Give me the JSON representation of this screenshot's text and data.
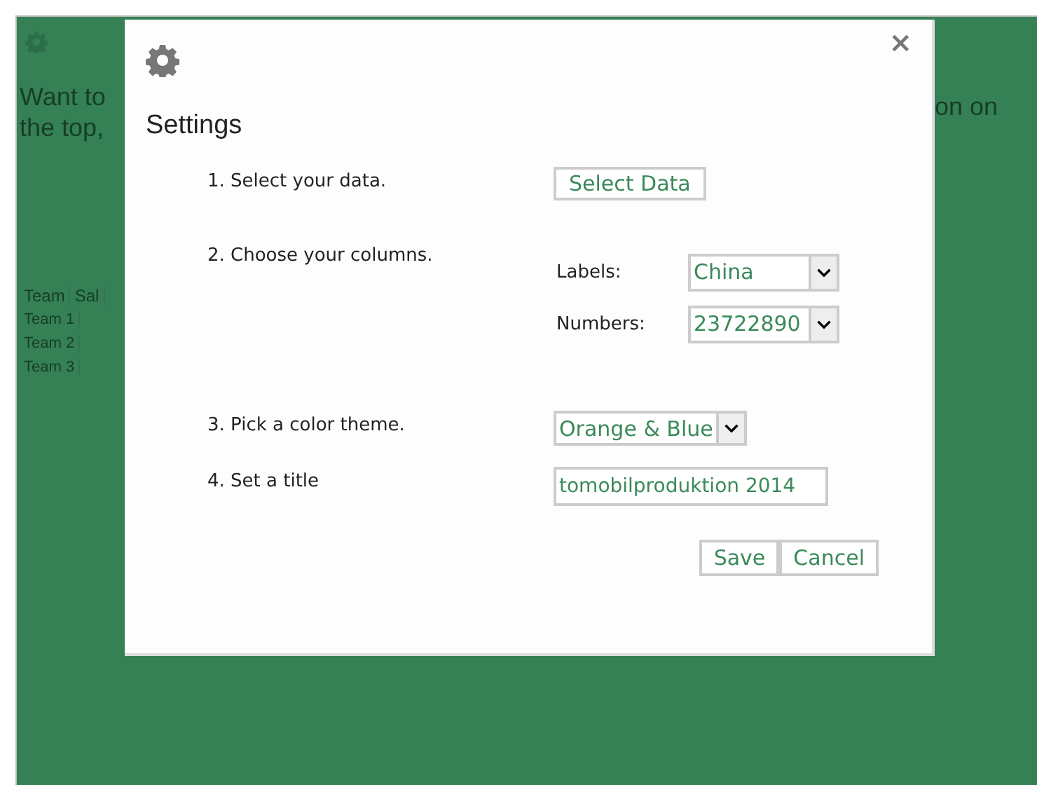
{
  "background": {
    "heading_left": [
      "Want to",
      "the top,"
    ],
    "heading_right": "on on",
    "table": {
      "columns": [
        "Team",
        "Sal"
      ],
      "rows": [
        "Team 1",
        "Team 2",
        "Team 3"
      ]
    }
  },
  "dialog": {
    "title": "Settings",
    "close": "×",
    "steps": [
      {
        "kind": "button",
        "label": "1. Select your data.",
        "button": "Select Data"
      },
      {
        "kind": "pairs",
        "label": "2. Choose your columns.",
        "pairs": [
          {
            "label": "Labels:",
            "value": "China"
          },
          {
            "label": "Numbers:",
            "value": "23722890"
          }
        ]
      },
      {
        "kind": "select",
        "label": "3. Pick a color theme.",
        "value": "Orange & Blue"
      },
      {
        "kind": "input",
        "label": "4. Set a title",
        "value": "tomobilproduktion 2014"
      }
    ],
    "buttons": [
      "Save",
      "Cancel"
    ]
  }
}
